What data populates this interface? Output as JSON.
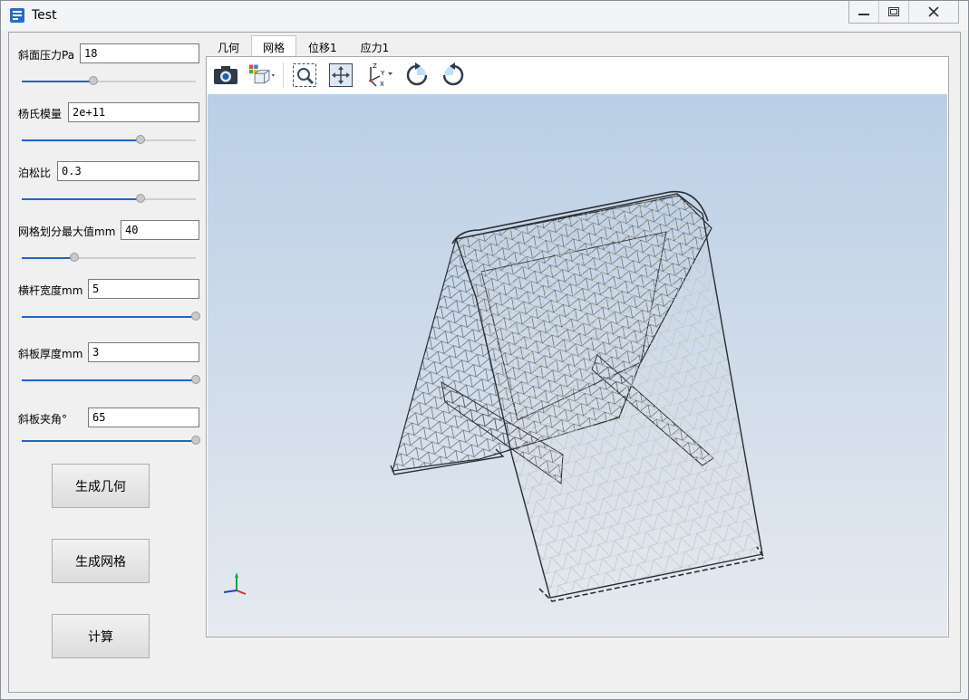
{
  "window": {
    "title": "Test",
    "icons": {
      "app": "app-logo-icon",
      "minimize": "minimize-icon",
      "maximize": "maximize-icon",
      "close": "close-icon"
    }
  },
  "params": [
    {
      "label": "斜面压力Pa",
      "value": "18",
      "slider_fraction": 0.41
    },
    {
      "label": "杨氏模量",
      "value": "2e+11",
      "slider_fraction": 0.68
    },
    {
      "label": "泊松比",
      "value": "0.3",
      "slider_fraction": 0.68
    },
    {
      "label": "网格划分最大值mm",
      "value": "40",
      "slider_fraction": 0.3
    },
    {
      "label": "横杆宽度mm",
      "value": "5",
      "slider_fraction": 1.0
    },
    {
      "label": "斜板厚度mm",
      "value": "3",
      "slider_fraction": 1.0
    },
    {
      "label": "斜板夹角°",
      "value": "65",
      "slider_fraction": 1.0
    }
  ],
  "buttons": {
    "generate_geometry": "生成几何",
    "generate_mesh": "生成网格",
    "compute": "计算"
  },
  "tabs": [
    {
      "label": "几何",
      "active": false
    },
    {
      "label": "网格",
      "active": true
    },
    {
      "label": "位移1",
      "active": false
    },
    {
      "label": "应力1",
      "active": false
    }
  ],
  "toolbar_icons": [
    "camera-icon",
    "view-cube-icon",
    "zoom-box-icon",
    "fit-all-icon",
    "axes-orientation-icon",
    "rotate-cw-icon",
    "rotate-ccw-icon"
  ],
  "colors": {
    "accent": "#1e66c8",
    "viewport_top": "#bacfe6",
    "viewport_bottom": "#e6eaf0"
  }
}
